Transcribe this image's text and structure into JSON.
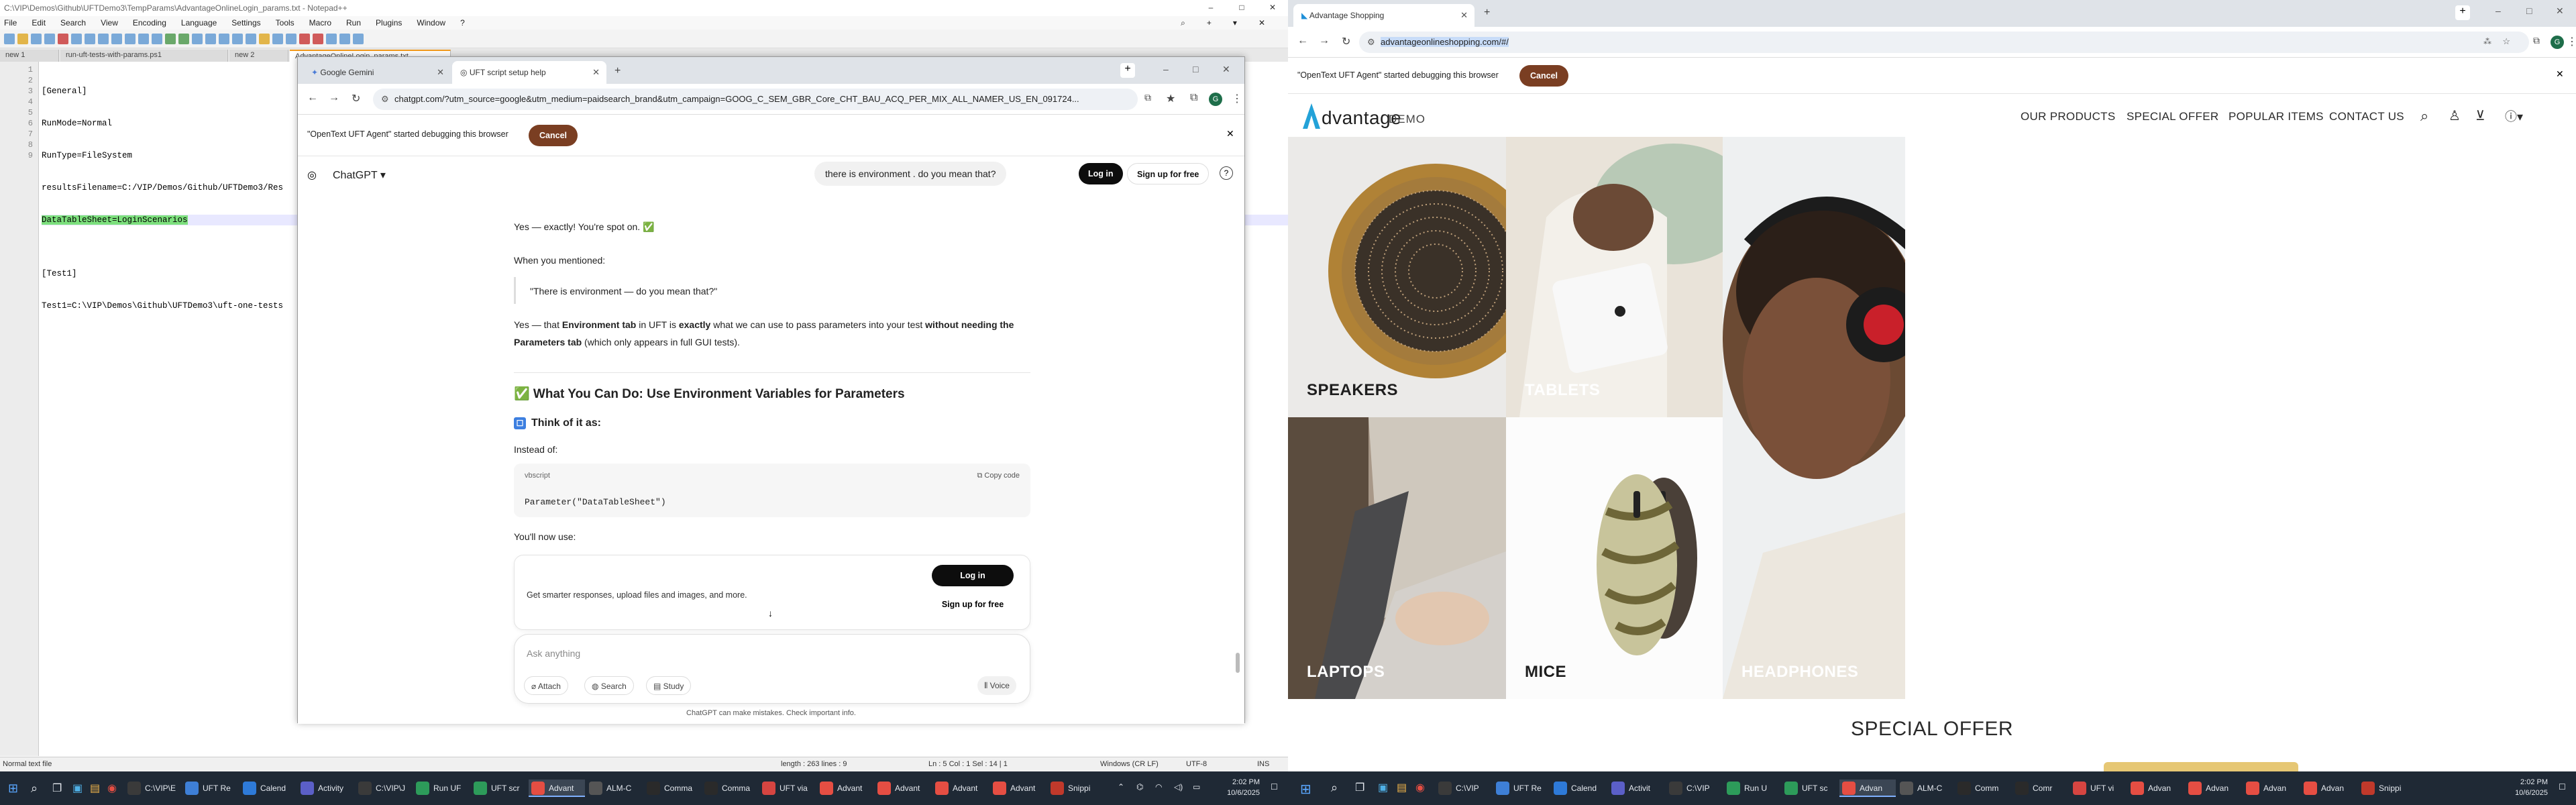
{
  "notepad": {
    "title": "C:\\VIP\\Demos\\Github\\UFTDemo3\\TempParams\\AdvantageOnlineLogin_params.txt - Notepad++",
    "menu": [
      "File",
      "Edit",
      "Search",
      "View",
      "Encoding",
      "Language",
      "Settings",
      "Tools",
      "Macro",
      "Run",
      "Plugins",
      "Window",
      "?"
    ],
    "tabs": [
      "new 1",
      "run-uft-tests-with-params.ps1",
      "new 2",
      "AdvantageOnlineLogin_params.txt"
    ],
    "lines": [
      "[General]",
      "RunMode=Normal",
      "RunType=FileSystem",
      "resultsFilename=C:/VIP/Demos/Github/UFTDemo3/Res",
      "DataTableSheet=LoginScenarios",
      "",
      "[Test1]",
      "Test1=C:\\VIP\\Demos\\Github\\UFTDemo3\\uft-one-tests"
    ],
    "line_numbers": [
      "1",
      "2",
      "3",
      "4",
      "5",
      "6",
      "7",
      "8",
      "9"
    ],
    "status": {
      "type": "Normal text file",
      "length": "length : 263   lines : 9",
      "pos": "Ln : 5   Col : 1   Sel : 14 | 1",
      "eol": "Windows (CR LF)",
      "enc": "UTF-8",
      "ins": "INS"
    }
  },
  "left_chrome": {
    "tabs": [
      "Google Gemini",
      "UFT script setup help"
    ],
    "url": "chatgpt.com/?utm_source=google&utm_medium=paidsearch_brand&utm_campaign=GOOG_C_SEM_GBR_Core_CHT_BAU_ACQ_PER_MIX_ALL_NAMER_US_EN_091724...",
    "debug_msg": "\"OpenText UFT Agent\" started debugging this browser",
    "cancel": "Cancel",
    "chat": {
      "brand": "ChatGPT",
      "login": "Log in",
      "signup": "Sign up for free",
      "user_msg": "there is environment . do you mean that?",
      "p1": "Yes — exactly! You're spot on. ✅",
      "p2": "When you mentioned:",
      "quote": "\"There is environment — do you mean that?\"",
      "p3a": "Yes — that ",
      "p3b": "Environment tab",
      "p3c": " in UFT is ",
      "p3d": "exactly",
      "p3e": " what we can use to pass parameters into your test ",
      "p3f": "without needing the Parameters tab",
      "p3g": " (which only appears in full GUI tests).",
      "h1": "✅ What You Can Do: Use Environment Variables for Parameters",
      "h2": "Think of it as:",
      "instead": "Instead of:",
      "code_lang": "vbscript",
      "copy": "Copy code",
      "code": "Parameter(\"DataTableSheet\")",
      "now_use": "You'll now use:",
      "promo_text": "Get smarter responses, upload files and images, and more.",
      "ask": "Ask anything",
      "attach": "Attach",
      "search": "Search",
      "study": "Study",
      "voice": "Voice",
      "footer": "ChatGPT can make mistakes. Check important info."
    }
  },
  "right_chrome": {
    "tab": "Advantage Shopping",
    "url": "advantageonlineshopping.com/#/",
    "debug_msg": "\"OpenText UFT Agent\" started debugging this browser",
    "cancel": "Cancel",
    "site": {
      "logo_main": "dvantage",
      "logo_sub": "DEMO",
      "nav": [
        "OUR PRODUCTS",
        "SPECIAL OFFER",
        "POPULAR ITEMS",
        "CONTACT US"
      ],
      "categories": [
        "SPEAKERS",
        "TABLETS",
        "HEADPHONES",
        "LAPTOPS",
        "MICE"
      ],
      "special_offer": "SPECIAL OFFER"
    }
  },
  "taskbar_left": {
    "items": [
      "C:\\VIP\\E",
      "UFT Re",
      "Calend",
      "Activity",
      "C:\\VIP\\J",
      "Run UF",
      "UFT scr",
      "Advant",
      "ALM-C",
      "Comma",
      "Comma",
      "UFT via",
      "Advant",
      "Advant",
      "Advant",
      "Advant",
      "Snippi"
    ],
    "time": "2:02 PM",
    "date": "10/6/2025"
  },
  "taskbar_right": {
    "items": [
      "C:\\VIP",
      "UFT Re",
      "Calend",
      "Activit",
      "C:\\VIP",
      "Run U",
      "UFT sc",
      "Advan",
      "ALM-C",
      "Comm",
      "Comr",
      "UFT vi",
      "Advan",
      "Advan",
      "Advan",
      "Advan",
      "Snippi"
    ],
    "time": "2:02 PM",
    "date": "10/6/2025"
  }
}
